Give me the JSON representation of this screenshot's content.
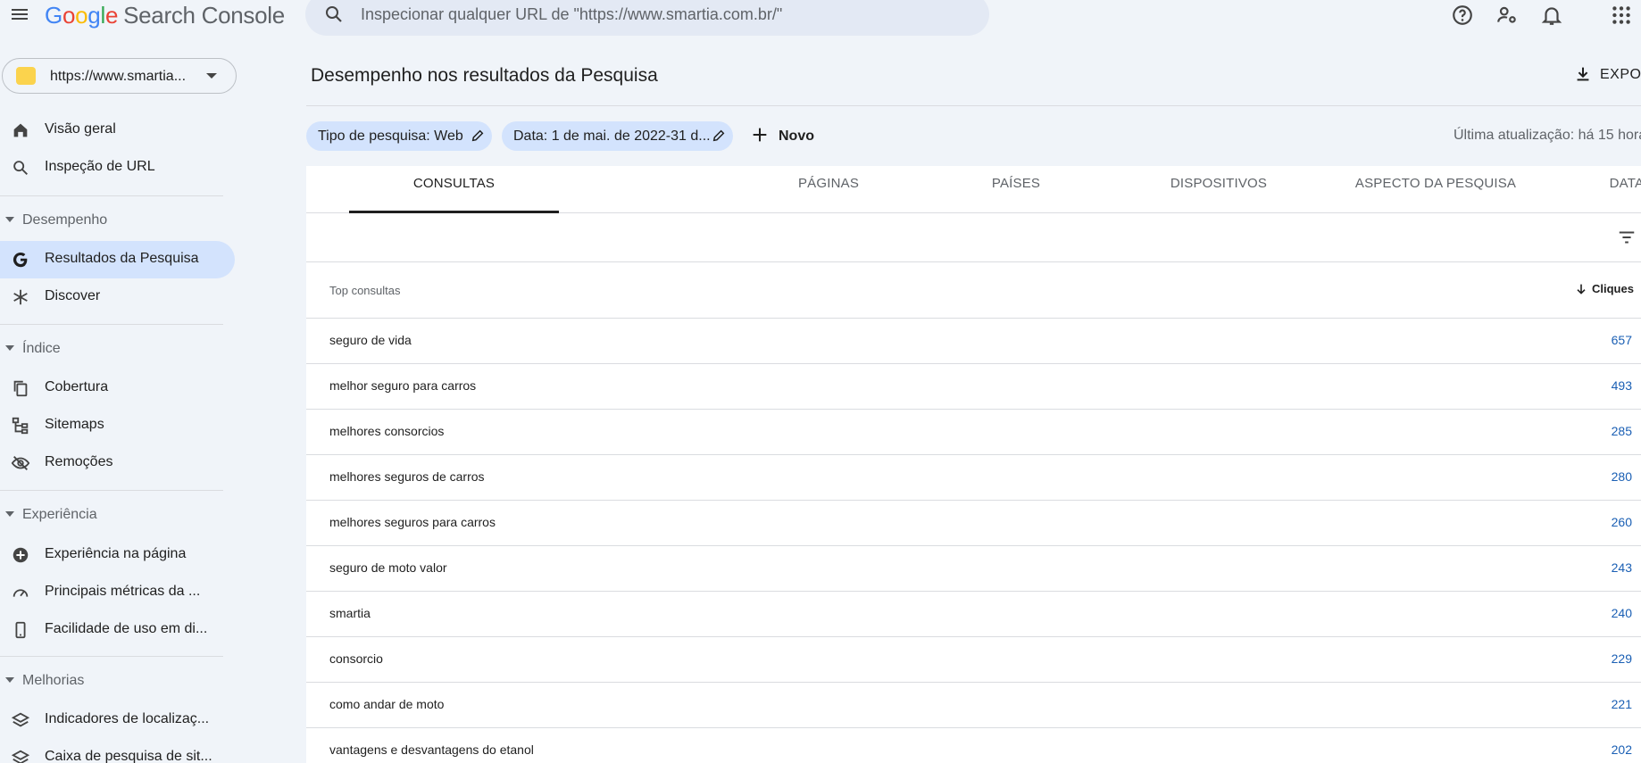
{
  "app": {
    "logo_letters": [
      "G",
      "o",
      "o",
      "g",
      "l",
      "e"
    ],
    "product": "Search Console"
  },
  "search": {
    "placeholder": "Inspecionar qualquer URL de \"https://www.smartia.com.br/\""
  },
  "property": {
    "label": "https://www.smartia..."
  },
  "sidebar": {
    "top_items": [
      {
        "label": "Visão geral",
        "icon": "home-icon"
      },
      {
        "label": "Inspeção de URL",
        "icon": "search-icon"
      }
    ],
    "sections": [
      {
        "label": "Desempenho",
        "items": [
          {
            "label": "Resultados da Pesquisa",
            "icon": "google-g-icon",
            "active": true
          },
          {
            "label": "Discover",
            "icon": "asterisk-icon"
          }
        ]
      },
      {
        "label": "Índice",
        "items": [
          {
            "label": "Cobertura",
            "icon": "copy-icon"
          },
          {
            "label": "Sitemaps",
            "icon": "sitemap-icon"
          },
          {
            "label": "Remoções",
            "icon": "visibility-off-icon"
          }
        ]
      },
      {
        "label": "Experiência",
        "items": [
          {
            "label": "Experiência na página",
            "icon": "add-circle-icon"
          },
          {
            "label": "Principais métricas da ...",
            "icon": "speed-icon"
          },
          {
            "label": "Facilidade de uso em di...",
            "icon": "phone-icon"
          }
        ]
      },
      {
        "label": "Melhorias",
        "items": [
          {
            "label": "Indicadores de localizaç...",
            "icon": "layers-icon"
          },
          {
            "label": "Caixa de pesquisa de sit...",
            "icon": "layers-icon"
          }
        ]
      }
    ]
  },
  "main": {
    "title": "Desempenho nos resultados da Pesquisa",
    "export_label": "EXPOR",
    "chips": [
      {
        "label": "Tipo de pesquisa: Web"
      },
      {
        "label": "Data: 1 de mai. de 2022-31 d..."
      }
    ],
    "new_label": "Novo",
    "last_updated": "Última atualização: há 15 hora",
    "tabs": [
      "CONSULTAS",
      "PÁGINAS",
      "PAÍSES",
      "DISPOSITIVOS",
      "ASPECTO DA PESQUISA",
      "DATAS"
    ],
    "active_tab": 0,
    "table": {
      "col_query": "Top consultas",
      "col_clicks": "Cliques",
      "rows": [
        {
          "query": "seguro de vida",
          "clicks": "657"
        },
        {
          "query": "melhor seguro para carros",
          "clicks": "493"
        },
        {
          "query": "melhores consorcios",
          "clicks": "285"
        },
        {
          "query": "melhores seguros de carros",
          "clicks": "280"
        },
        {
          "query": "melhores seguros para carros",
          "clicks": "260"
        },
        {
          "query": "seguro de moto valor",
          "clicks": "243"
        },
        {
          "query": "smartia",
          "clicks": "240"
        },
        {
          "query": "consorcio",
          "clicks": "229"
        },
        {
          "query": "como andar de moto",
          "clicks": "221"
        },
        {
          "query": "vantagens e desvantagens do etanol",
          "clicks": "202"
        }
      ]
    }
  },
  "colors": {
    "background": "#f0f4f9",
    "active_nav": "#d3e3fd",
    "clicks_text": "#1a5fb4"
  }
}
